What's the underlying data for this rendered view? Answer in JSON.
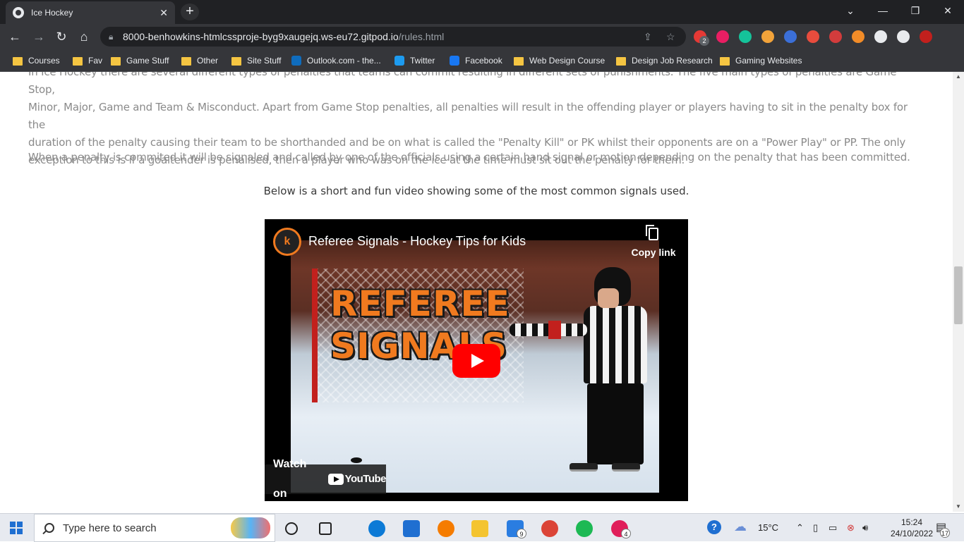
{
  "browser": {
    "tab_title": "Ice Hockey",
    "tab_close": "✕",
    "new_tab": "+",
    "window_controls": {
      "dropdown": "⌄",
      "minimize": "—",
      "restore": "❐",
      "close": "✕"
    },
    "url_host": "8000-benhowkins-htmlcssproje-byg9xaugejq.ws-eu72.gitpod.io",
    "url_path": "/rules.html",
    "extensions": [
      {
        "name": "extension-red-icon",
        "color": "#e53935",
        "badge": "2"
      },
      {
        "name": "extension-pink-icon",
        "color": "#e91e63"
      },
      {
        "name": "grammarly-icon",
        "color": "#15c39a"
      },
      {
        "name": "key-icon",
        "color": "#f2a33a"
      },
      {
        "name": "extension-blue-n-icon",
        "color": "#3b6fd8"
      },
      {
        "name": "extension-red-c-icon",
        "color": "#e84c3d"
      },
      {
        "name": "extension-cast-icon",
        "color": "#d23c3c"
      },
      {
        "name": "extension-orange-icon",
        "color": "#f28c28"
      },
      {
        "name": "puzzle-icon",
        "color": "#e8eaed"
      },
      {
        "name": "sidepanel-icon",
        "color": "#e8eaed"
      },
      {
        "name": "profile-avatar-icon",
        "color": "#c2201d"
      }
    ],
    "bookmarks": [
      {
        "label": "Courses",
        "icon": "folder"
      },
      {
        "label": "Fav",
        "icon": "folder"
      },
      {
        "label": "Game Stuff",
        "icon": "folder"
      },
      {
        "label": "Other",
        "icon": "folder"
      },
      {
        "label": "Site Stuff",
        "icon": "folder"
      },
      {
        "label": "Outlook.com - the...",
        "icon": "outlook",
        "color": "#0f6cbd"
      },
      {
        "label": "Twitter",
        "icon": "twitter",
        "color": "#1d9bf0"
      },
      {
        "label": "Facebook",
        "icon": "facebook",
        "color": "#1877f2"
      },
      {
        "label": "Web Design Course",
        "icon": "folder"
      },
      {
        "label": "Design Job Research",
        "icon": "folder"
      },
      {
        "label": "Gaming Websites",
        "icon": "folder"
      }
    ]
  },
  "page": {
    "para_line0": "In Ice Hockey there are several different types of penalties that teams can commit resulting in different sets of punishments. The five main types of penalties are Game Stop,",
    "para_line1": "Minor, Major, Game and Team & Misconduct. Apart from Game Stop penalties, all penalties will result in the offending player or players having to sit in the penalty box for the",
    "para_line2": "duration of the penalty causing their team to be shorthanded and be on what is called the \"Penalty Kill\" or PK whilst their opponents are on a \"Power Play\" or PP. The only",
    "para_line3": "exception to this is if a goaltender is penalised, then a player who was on the ice at the time must sit out the penalty for them.",
    "para2": "When a penalty is commited it will be signaled and called by one of the officials using a certain hand signal or motion depending on the penalty that has been committed.",
    "caption": "Below is a short and fun video showing some of the most common signals used.",
    "video": {
      "title": "Referee Signals - Hockey Tips for Kids",
      "channel_logo": "k",
      "copy_link": "Copy link",
      "thumb_text": [
        "REFEREE",
        "SIGNALS"
      ],
      "watch_on": "Watch on",
      "youtube": "YouTube"
    }
  },
  "taskbar": {
    "search_placeholder": "Type here to search",
    "apps": [
      {
        "name": "task-view-icon"
      },
      {
        "name": "widgets-icon"
      },
      {
        "name": "edge-icon",
        "color": "#0c7ad6"
      },
      {
        "name": "store-icon",
        "color": "#1f6fd1"
      },
      {
        "name": "firefox-icon",
        "color": "#f57c00"
      },
      {
        "name": "file-explorer-icon",
        "color": "#f4c430"
      },
      {
        "name": "mail-icon",
        "color": "#2a7de1",
        "badge": "9"
      },
      {
        "name": "chrome-icon",
        "color": "#db4437"
      },
      {
        "name": "spotify-icon",
        "color": "#1db954"
      },
      {
        "name": "slack-icon",
        "color": "#e01e5a",
        "badge": "4"
      }
    ],
    "weather": "15°C",
    "time": "15:24",
    "date": "24/10/2022",
    "notification_count": "17"
  }
}
